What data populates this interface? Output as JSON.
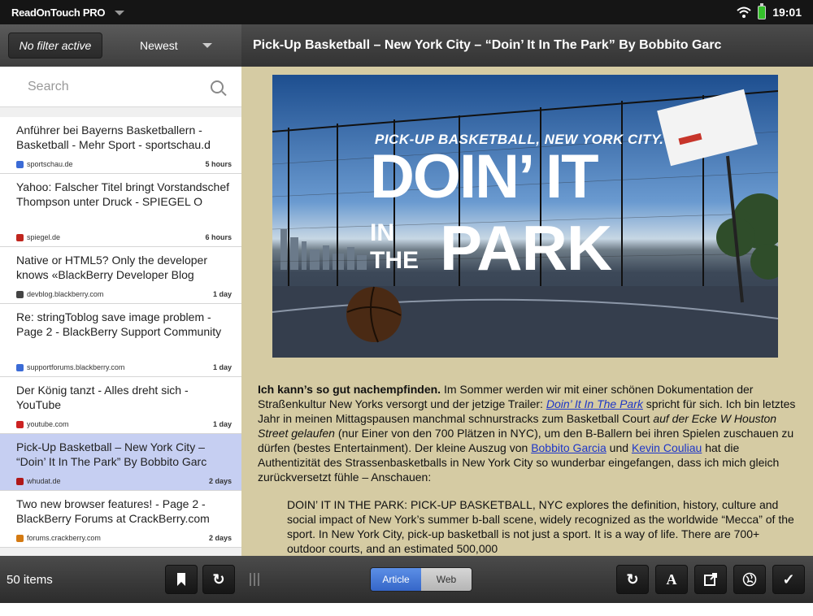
{
  "status_bar": {
    "app_title": "ReadOnTouch PRO",
    "time": "19:01"
  },
  "filter": {
    "label": "No filter active",
    "sort": "Newest"
  },
  "search": {
    "placeholder": "Search"
  },
  "items": [
    {
      "title": "Anführer bei Bayerns Basketballern - Basketball - Mehr Sport - sportschau.d",
      "source": "sportschau.de",
      "time": "5 hours",
      "color": "#3b6bd6"
    },
    {
      "title": "Yahoo: Falscher Titel bringt Vorstandschef Thompson unter Druck - SPIEGEL O",
      "source": "spiegel.de",
      "time": "6 hours",
      "color": "#c0261e"
    },
    {
      "title": "Native or HTML5? Only the developer knows «BlackBerry Developer Blog",
      "source": "devblog.blackberry.com",
      "time": "1 day",
      "color": "#444444"
    },
    {
      "title": "Re: stringToblog save image problem - Page 2 - BlackBerry Support Community",
      "source": "supportforums.blackberry.com",
      "time": "1 day",
      "color": "#3b6bd6"
    },
    {
      "title": "Der König tanzt - Alles dreht sich - YouTube",
      "source": "youtube.com",
      "time": "1 day",
      "color": "#cc2222"
    },
    {
      "title": "Pick-Up Basketball – New York City – “Doin’ It In The Park” By Bobbito Garc",
      "source": "whudat.de",
      "time": "2 days",
      "color": "#b01818",
      "selected": true
    },
    {
      "title": "Two new browser features! - Page 2 - BlackBerry Forums at CrackBerry.com",
      "source": "forums.crackberry.com",
      "time": "2 days",
      "color": "#d47a12"
    }
  ],
  "list_footer": {
    "count": "50 items"
  },
  "article": {
    "title": "Pick-Up Basketball – New York City – “Doin’ It In The Park” By Bobbito Garc",
    "hero": {
      "line1": "PICK-UP BASKETBALL, NEW YORK CITY.",
      "line2": "DOIN’ IT",
      "small": "IN\nTHE",
      "line3": "PARK"
    },
    "p_bold": "Ich kann’s so gut nachempfinden.",
    "p1": " Im Sommer werden wir mit einer schönen Dokumentation der Straßenkultur New Yorks versorgt und der jetzige Trailer: ",
    "link_trailer": "Doin’ It In The Park",
    "p2": " spricht für sich. Ich bin letztes Jahr in meinen Mittagspausen manchmal schnurstracks zum Basketball Court ",
    "p2_italic": "auf der Ecke W Houston Street gelaufen",
    "p3": " (nur Einer von den 700 Plätzen in NYC), um den B-Ballern bei ihren Spielen zuschauen zu dürfen (bestes Entertainment). Der kleine Auszug von ",
    "link_bobbito": "Bobbito Garcia",
    "p4": " und ",
    "link_kevin": "Kevin Couliau",
    "p5": " hat die Authentizität des Strassenbasketballs in New York City so wunderbar eingefangen, dass ich mich gleich zurückversetzt fühle – Anschauen:",
    "quote": "DOIN’ IT IN THE PARK: PICK-UP BASKETBALL, NYC explores the definition, history, culture and social impact of New York’s summer b-ball scene, widely recognized as the worldwide “Mecca” of the sport. In New York City, pick-up basketball is not just a sport. It is a way of life. There are 700+ outdoor courts, and an estimated 500,000"
  },
  "toolbar": {
    "tab_article": "Article",
    "tab_web": "Web"
  }
}
